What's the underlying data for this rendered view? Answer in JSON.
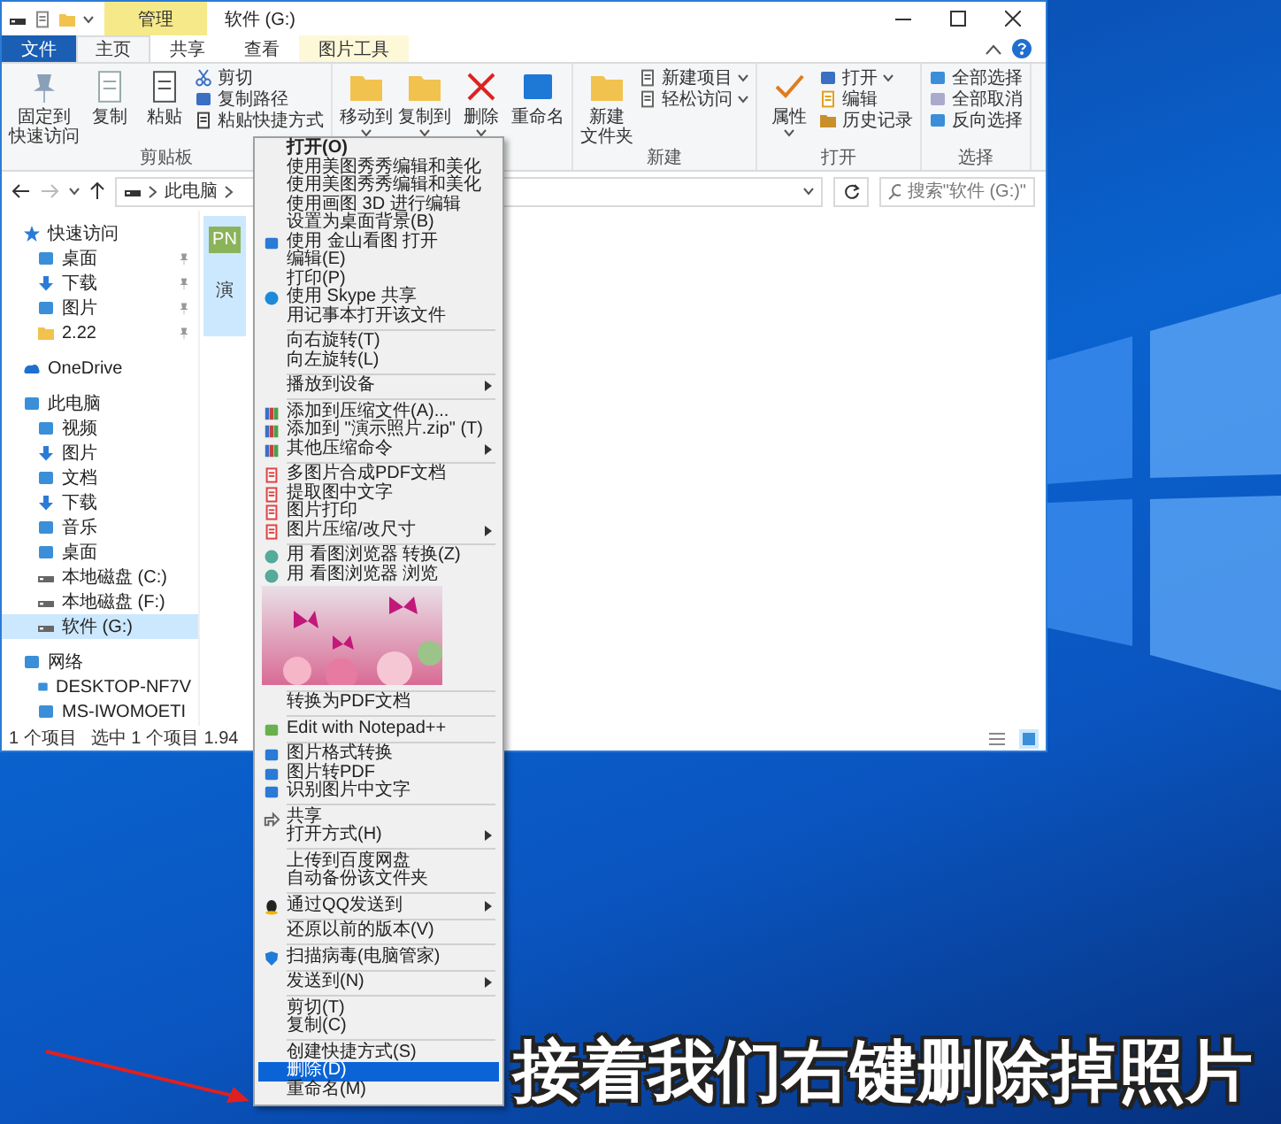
{
  "window": {
    "title": "软件 (G:)",
    "context_tab": "管理"
  },
  "ribbon": {
    "tabs": [
      {
        "label": "文件",
        "kind": "file",
        "selected": false
      },
      {
        "label": "主页",
        "kind": "tab",
        "selected": true
      },
      {
        "label": "共享",
        "kind": "tab",
        "selected": false
      },
      {
        "label": "查看",
        "kind": "tab",
        "selected": false
      },
      {
        "label": "图片工具",
        "kind": "context",
        "selected": false
      }
    ],
    "groups": [
      {
        "label": "剪贴板",
        "items": [
          {
            "kind": "large",
            "label": [
              "固定到",
              "快速访问"
            ],
            "dropdown": false
          },
          {
            "kind": "large",
            "label": "复制",
            "dropdown": false
          },
          {
            "kind": "large",
            "label": "粘贴",
            "dropdown": false
          },
          {
            "kind": "stack",
            "items": [
              {
                "label": "剪切",
                "dropdown": false
              },
              {
                "label": "复制路径",
                "dropdown": false
              },
              {
                "label": "粘贴快捷方式",
                "dropdown": false
              }
            ]
          }
        ]
      },
      {
        "items": [
          {
            "kind": "large",
            "label": "移动到",
            "dropdown": true
          },
          {
            "kind": "large",
            "label": "复制到",
            "dropdown": true
          },
          {
            "kind": "large",
            "label": "删除",
            "dropdown": true
          },
          {
            "kind": "large",
            "label": "重命名",
            "dropdown": false
          }
        ]
      },
      {
        "label": "新建",
        "items": [
          {
            "kind": "large",
            "label": [
              "新建",
              "文件夹"
            ],
            "dropdown": false
          },
          {
            "kind": "stack",
            "items": [
              {
                "label": "新建项目",
                "dropdown": true
              },
              {
                "label": "轻松访问",
                "dropdown": true
              }
            ]
          }
        ]
      },
      {
        "label": "打开",
        "items": [
          {
            "kind": "large",
            "label": "属性",
            "dropdown": true
          },
          {
            "kind": "stack",
            "items": [
              {
                "label": "打开",
                "dropdown": true
              },
              {
                "label": "编辑",
                "dropdown": false
              },
              {
                "label": "历史记录",
                "dropdown": false
              }
            ]
          }
        ]
      },
      {
        "label": "选择",
        "items": [
          {
            "kind": "stack",
            "items": [
              {
                "label": "全部选择",
                "dropdown": false
              },
              {
                "label": "全部取消",
                "dropdown": false
              },
              {
                "label": "反向选择",
                "dropdown": false
              }
            ]
          }
        ]
      }
    ]
  },
  "address_bar": {
    "path": [
      "此电脑"
    ],
    "search_placeholder": "搜索\"软件 (G:)\""
  },
  "nav_pane": {
    "items": [
      {
        "label": "快速访问",
        "selected": false,
        "children": [
          {
            "label": "桌面",
            "selected": false,
            "pinned": true
          },
          {
            "label": "下载",
            "selected": false,
            "pinned": true
          },
          {
            "label": "图片",
            "selected": false,
            "pinned": true
          },
          {
            "label": "2.22",
            "selected": false,
            "pinned": true
          }
        ]
      },
      {
        "label": "OneDrive",
        "selected": false
      },
      {
        "label": "此电脑",
        "selected": false,
        "children": [
          {
            "label": "视频",
            "selected": false
          },
          {
            "label": "图片",
            "selected": false
          },
          {
            "label": "文档",
            "selected": false
          },
          {
            "label": "下载",
            "selected": false
          },
          {
            "label": "音乐",
            "selected": false
          },
          {
            "label": "桌面",
            "selected": false
          },
          {
            "label": "本地磁盘 (C:)",
            "selected": false
          },
          {
            "label": "本地磁盘 (F:)",
            "selected": false
          },
          {
            "label": "软件 (G:)",
            "selected": true
          }
        ]
      },
      {
        "label": "网络",
        "selected": false,
        "children": [
          {
            "label": "DESKTOP-NF7V",
            "selected": false
          },
          {
            "label": "MS-IWOMOETI",
            "selected": false
          }
        ]
      }
    ]
  },
  "files": [
    {
      "label": "演",
      "badge": "PN",
      "selected": true
    }
  ],
  "status_bar": {
    "count": "1 个项目",
    "selection": "选中 1 个项目 1.94"
  },
  "context_menu": {
    "items": [
      {
        "kind": "default",
        "label": "打开(O)",
        "submenu": false,
        "selected": false
      },
      {
        "kind": "item",
        "label": "使用美图秀秀编辑和美化",
        "submenu": false,
        "selected": false
      },
      {
        "kind": "item",
        "label": "使用美图秀秀编辑和美化",
        "submenu": false,
        "selected": false
      },
      {
        "kind": "item",
        "label": "使用画图 3D 进行编辑",
        "submenu": false,
        "selected": false
      },
      {
        "kind": "item",
        "label": "设置为桌面背景(B)",
        "submenu": false,
        "selected": false
      },
      {
        "kind": "item",
        "label": "使用 金山看图 打开",
        "submenu": false,
        "selected": false
      },
      {
        "kind": "item",
        "label": "编辑(E)",
        "submenu": false,
        "selected": false
      },
      {
        "kind": "item",
        "label": "打印(P)",
        "submenu": false,
        "selected": false
      },
      {
        "kind": "item",
        "label": "使用 Skype 共享",
        "submenu": false,
        "selected": false
      },
      {
        "kind": "item",
        "label": "用记事本打开该文件",
        "submenu": false,
        "selected": false
      },
      {
        "kind": "separator"
      },
      {
        "kind": "item",
        "label": "向右旋转(T)",
        "submenu": false,
        "selected": false
      },
      {
        "kind": "item",
        "label": "向左旋转(L)",
        "submenu": false,
        "selected": false
      },
      {
        "kind": "separator"
      },
      {
        "kind": "item",
        "label": "播放到设备",
        "submenu": true,
        "selected": false
      },
      {
        "kind": "separator"
      },
      {
        "kind": "item",
        "label": "添加到压缩文件(A)...",
        "submenu": false,
        "selected": false
      },
      {
        "kind": "item",
        "label": "添加到 \"演示照片.zip\" (T)",
        "submenu": false,
        "selected": false
      },
      {
        "kind": "item",
        "label": "其他压缩命令",
        "submenu": true,
        "selected": false
      },
      {
        "kind": "separator"
      },
      {
        "kind": "item",
        "label": "多图片合成PDF文档",
        "submenu": false,
        "selected": false
      },
      {
        "kind": "item",
        "label": "提取图中文字",
        "submenu": false,
        "selected": false
      },
      {
        "kind": "item",
        "label": "图片打印",
        "submenu": false,
        "selected": false
      },
      {
        "kind": "item",
        "label": "图片压缩/改尺寸",
        "submenu": true,
        "selected": false
      },
      {
        "kind": "separator"
      },
      {
        "kind": "item",
        "label": "用 看图浏览器 转换(Z)",
        "submenu": false,
        "selected": false
      },
      {
        "kind": "item",
        "label": "用 看图浏览器 浏览",
        "submenu": false,
        "selected": false
      },
      {
        "kind": "image"
      },
      {
        "kind": "separator"
      },
      {
        "kind": "item",
        "label": "转换为PDF文档",
        "submenu": false,
        "selected": false
      },
      {
        "kind": "separator"
      },
      {
        "kind": "item",
        "label": "Edit with Notepad++",
        "submenu": false,
        "selected": false
      },
      {
        "kind": "separator"
      },
      {
        "kind": "item",
        "label": "图片格式转换",
        "submenu": false,
        "selected": false
      },
      {
        "kind": "item",
        "label": "图片转PDF",
        "submenu": false,
        "selected": false
      },
      {
        "kind": "item",
        "label": "识别图片中文字",
        "submenu": false,
        "selected": false
      },
      {
        "kind": "separator"
      },
      {
        "kind": "item",
        "label": "共享",
        "submenu": false,
        "selected": false
      },
      {
        "kind": "item",
        "label": "打开方式(H)",
        "submenu": true,
        "selected": false
      },
      {
        "kind": "separator"
      },
      {
        "kind": "item",
        "label": "上传到百度网盘",
        "submenu": false,
        "selected": false
      },
      {
        "kind": "item",
        "label": "自动备份该文件夹",
        "submenu": false,
        "selected": false
      },
      {
        "kind": "separator"
      },
      {
        "kind": "item",
        "label": "通过QQ发送到",
        "submenu": true,
        "selected": false
      },
      {
        "kind": "separator"
      },
      {
        "kind": "item",
        "label": "还原以前的版本(V)",
        "submenu": false,
        "selected": false
      },
      {
        "kind": "separator"
      },
      {
        "kind": "item",
        "label": "扫描病毒(电脑管家)",
        "submenu": false,
        "selected": false
      },
      {
        "kind": "separator"
      },
      {
        "kind": "item",
        "label": "发送到(N)",
        "submenu": true,
        "selected": false
      },
      {
        "kind": "separator"
      },
      {
        "kind": "item",
        "label": "剪切(T)",
        "submenu": false,
        "selected": false
      },
      {
        "kind": "item",
        "label": "复制(C)",
        "submenu": false,
        "selected": false
      },
      {
        "kind": "separator"
      },
      {
        "kind": "item",
        "label": "创建快捷方式(S)",
        "submenu": false,
        "selected": false
      },
      {
        "kind": "item",
        "label": "删除(D)",
        "submenu": false,
        "selected": true
      },
      {
        "kind": "item",
        "label": "重命名(M)",
        "submenu": false,
        "selected": false
      }
    ]
  },
  "caption": "接着我们右键删除掉照片"
}
